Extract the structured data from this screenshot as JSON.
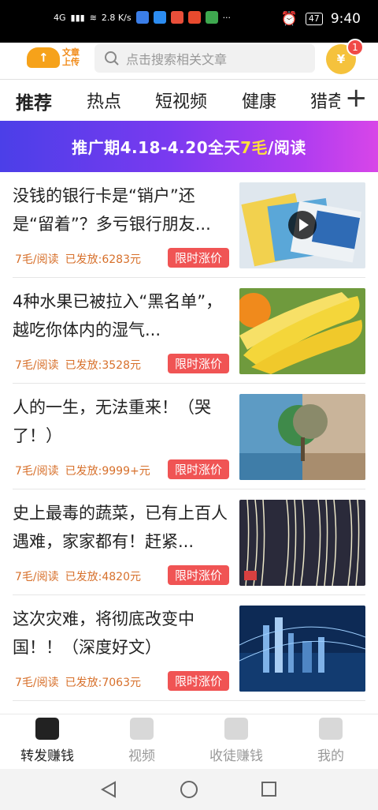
{
  "status_bar": {
    "network": "4G",
    "speed": "2.8 K/s",
    "battery": "47",
    "time": "9:40",
    "app_icon_colors": [
      "#3b7ee8",
      "#2c8cf0",
      "#e94f3a",
      "#e84a2e",
      "#3ea84f"
    ]
  },
  "header": {
    "logo_text_line1": "文章",
    "logo_text_line2": "上传",
    "search_placeholder": "点击搜索相关文章",
    "coin_symbol": "¥",
    "badge_count": "1"
  },
  "tabs": [
    {
      "label": "推荐",
      "active": true
    },
    {
      "label": "热点",
      "active": false
    },
    {
      "label": "短视频",
      "active": false
    },
    {
      "label": "健康",
      "active": false
    },
    {
      "label": "猎奇",
      "active": false
    }
  ],
  "tab_add_symbol": "+",
  "banner": {
    "prefix": "推广期4.18-4.20全天",
    "highlight": "7毛",
    "suffix": "/阅读"
  },
  "articles": [
    {
      "title": "没钱的银行卡是“销户”还是“留着”？多亏银行朋友...",
      "price": "7毛/阅读",
      "sent": "已发放:6283元",
      "tag": "限时涨价",
      "thumb": "bank-cards-video",
      "has_video": true
    },
    {
      "title": "4种水果已被拉入“黑名单”，越吃你体内的湿气...",
      "price": "7毛/阅读",
      "sent": "已发放:3528元",
      "tag": "限时涨价",
      "thumb": "bananas",
      "has_video": false
    },
    {
      "title": "人的一生，无法重来！（哭了！）",
      "price": "7毛/阅读",
      "sent": "已发放:9999+元",
      "tag": "限时涨价",
      "thumb": "tree-sea",
      "has_video": false
    },
    {
      "title": "史上最毒的蔬菜，已有上百人遇难，家家都有！赶紧...",
      "price": "7毛/阅读",
      "sent": "已发放:4820元",
      "tag": "限时涨价",
      "thumb": "bean-sprouts",
      "has_video": false
    },
    {
      "title": "这次灾难，将彻底改变中国！！（深度好文）",
      "price": "7毛/阅读",
      "sent": "已发放:7063元",
      "tag": "限时涨价",
      "thumb": "city-night",
      "has_video": false
    }
  ],
  "bottom_nav": [
    {
      "label": "转发赚钱",
      "icon": "article-icon",
      "active": true
    },
    {
      "label": "视频",
      "icon": "video-icon",
      "active": false
    },
    {
      "label": "收徒赚钱",
      "icon": "user-add-icon",
      "active": false
    },
    {
      "label": "我的",
      "icon": "face-icon",
      "active": false
    }
  ]
}
